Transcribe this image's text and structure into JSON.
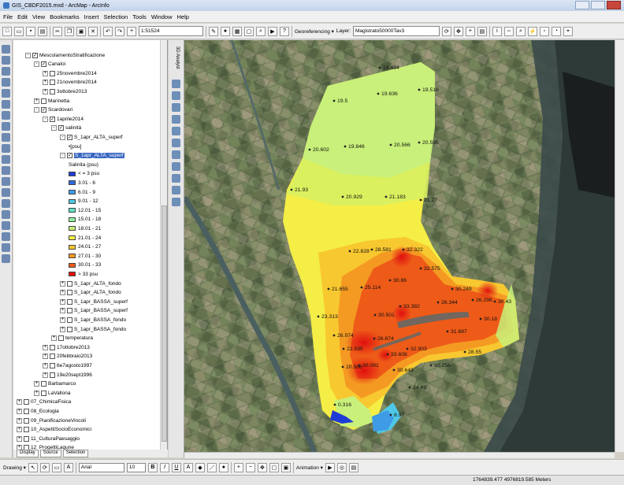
{
  "window": {
    "title": "GIS_CBDF2015.mxd - ArcMap - ArcInfo"
  },
  "menu": [
    "File",
    "Edit",
    "View",
    "Bookmarks",
    "Insert",
    "Selection",
    "Tools",
    "Window",
    "Help"
  ],
  "toolbar": {
    "scale": "1:51524",
    "georeferencing_label": "Georeferencing ▾",
    "layer_label": "Layer:",
    "layer_value": "Magistrato50000Tav3"
  },
  "toc": {
    "rows": [
      {
        "label": "MescolamentoStratificazione",
        "indent": 1,
        "exp": "-",
        "chk": true
      },
      {
        "label": "Canaloi",
        "indent": 2,
        "exp": "-",
        "chk": true
      },
      {
        "label": "25novembre2014",
        "indent": 3,
        "exp": "+",
        "chk": false
      },
      {
        "label": "21novembre2014",
        "indent": 3,
        "exp": "+",
        "chk": false
      },
      {
        "label": "3ottobre2013",
        "indent": 3,
        "exp": "+",
        "chk": false
      },
      {
        "label": "Marinetta",
        "indent": 2,
        "exp": "+",
        "chk": false
      },
      {
        "label": "Scardovari",
        "indent": 2,
        "exp": "-",
        "chk": true
      },
      {
        "label": "1aprile2014",
        "indent": 3,
        "exp": "-",
        "chk": true
      },
      {
        "label": "salinità",
        "indent": 4,
        "exp": "-",
        "chk": true
      },
      {
        "label": "S_1apr_ALTA_superf",
        "indent": 5,
        "exp": "-",
        "chk": true
      },
      {
        "label": "[psu]",
        "indent": 6,
        "exp": "",
        "chk": null,
        "bullet": true
      },
      {
        "label": "S_1apr_ALTA_superf",
        "indent": 5,
        "exp": "-",
        "chk": true,
        "highlight": true
      },
      {
        "label": "Salinita (psu)",
        "indent": 6,
        "exp": "",
        "chk": null
      }
    ],
    "legend": [
      {
        "label": "< = 3 psu",
        "color": "#1f3bd6"
      },
      {
        "label": "3.01 - 6",
        "color": "#2f6be0"
      },
      {
        "label": "6.01 - 9",
        "color": "#3f9be6"
      },
      {
        "label": "9.01 - 12",
        "color": "#4ec8e6"
      },
      {
        "label": "12.01 - 15",
        "color": "#60e0c8"
      },
      {
        "label": "15.01 - 18",
        "color": "#8ef0a0"
      },
      {
        "label": "18.01 - 21",
        "color": "#c8f07a"
      },
      {
        "label": "21.01 - 24",
        "color": "#f4f046"
      },
      {
        "label": "24.01 - 27",
        "color": "#f8c830"
      },
      {
        "label": "27.01 - 30",
        "color": "#f49a22"
      },
      {
        "label": "30.01 - 33",
        "color": "#ee5a18"
      },
      {
        "label": "> 33 psu",
        "color": "#e01010"
      }
    ],
    "rows2": [
      {
        "label": "S_1apr_ALTA_fondo",
        "indent": 5,
        "exp": "+",
        "chk": false
      },
      {
        "label": "S_1apr_ALTA_fondo",
        "indent": 5,
        "exp": "+",
        "chk": false
      },
      {
        "label": "S_1apr_BASSA_superf",
        "indent": 5,
        "exp": "+",
        "chk": false
      },
      {
        "label": "S_1apr_BASSA_superf",
        "indent": 5,
        "exp": "+",
        "chk": false
      },
      {
        "label": "S_1apr_BASSA_fondo",
        "indent": 5,
        "exp": "+",
        "chk": false
      },
      {
        "label": "S_1apr_BASSA_fondo",
        "indent": 5,
        "exp": "+",
        "chk": false
      },
      {
        "label": "temperatura",
        "indent": 4,
        "exp": "+",
        "chk": false
      },
      {
        "label": "17ottobre2013",
        "indent": 3,
        "exp": "+",
        "chk": false
      },
      {
        "label": "20febbraio2013",
        "indent": 3,
        "exp": "+",
        "chk": false
      },
      {
        "label": "6e7agosto1997",
        "indent": 3,
        "exp": "+",
        "chk": false
      },
      {
        "label": "19e20sept1996",
        "indent": 3,
        "exp": "+",
        "chk": false
      },
      {
        "label": "Barbamarco",
        "indent": 2,
        "exp": "+",
        "chk": false
      },
      {
        "label": "LaVallona",
        "indent": 2,
        "exp": "+",
        "chk": false
      },
      {
        "label": "07_ChimicaFisica",
        "indent": 0,
        "exp": "+",
        "chk": false
      },
      {
        "label": "08_Ecologia",
        "indent": 0,
        "exp": "+",
        "chk": false
      },
      {
        "label": "09_PianificazioneVincoli",
        "indent": 0,
        "exp": "+",
        "chk": false
      },
      {
        "label": "10_AspettiSocioEconomici",
        "indent": 0,
        "exp": "+",
        "chk": false
      },
      {
        "label": "11_CulturaPaesaggio",
        "indent": 0,
        "exp": "+",
        "chk": false
      },
      {
        "label": "12_ProgettiLagune",
        "indent": 0,
        "exp": "+",
        "chk": false
      },
      {
        "label": "13_ModelliMatematici",
        "indent": 0,
        "exp": "+",
        "chk": false
      }
    ],
    "tabs": [
      "Display",
      "Source",
      "Selection"
    ]
  },
  "side_strip_label": "3D Analyst",
  "map_labels": [
    {
      "t": "19.484"
    },
    {
      "t": "19.5"
    },
    {
      "t": "19.636"
    },
    {
      "t": "19.516"
    },
    {
      "t": "20.602"
    },
    {
      "t": "19.846"
    },
    {
      "t": "20.566"
    },
    {
      "t": "20.595"
    },
    {
      "t": "21.93"
    },
    {
      "t": "20.929"
    },
    {
      "t": "21.183"
    },
    {
      "t": "21.27"
    },
    {
      "t": "22.828"
    },
    {
      "t": "28.581"
    },
    {
      "t": "32.322"
    },
    {
      "t": "32.575"
    },
    {
      "t": "30.86"
    },
    {
      "t": "21.655"
    },
    {
      "t": "25.114"
    },
    {
      "t": "33.382"
    },
    {
      "t": "30.501"
    },
    {
      "t": "26.344"
    },
    {
      "t": "30.249"
    },
    {
      "t": "26.296"
    },
    {
      "t": "30.43"
    },
    {
      "t": "30.18"
    },
    {
      "t": "23.313"
    },
    {
      "t": "26.974"
    },
    {
      "t": "22.595"
    },
    {
      "t": "26.674"
    },
    {
      "t": "32.903"
    },
    {
      "t": "31.687"
    },
    {
      "t": "28.55"
    },
    {
      "t": "33.608"
    },
    {
      "t": "20.586"
    },
    {
      "t": "30.091"
    },
    {
      "t": "30.643"
    },
    {
      "t": "30.256"
    },
    {
      "t": "24.69"
    },
    {
      "t": "0.316"
    },
    {
      "t": "8.97"
    }
  ],
  "drawing": {
    "label": "Drawing ▾",
    "font": "Arial",
    "size": "10",
    "animation": "Animation ▾"
  },
  "status": {
    "coordinates": "1764839.477  4976819.585 Meters"
  }
}
